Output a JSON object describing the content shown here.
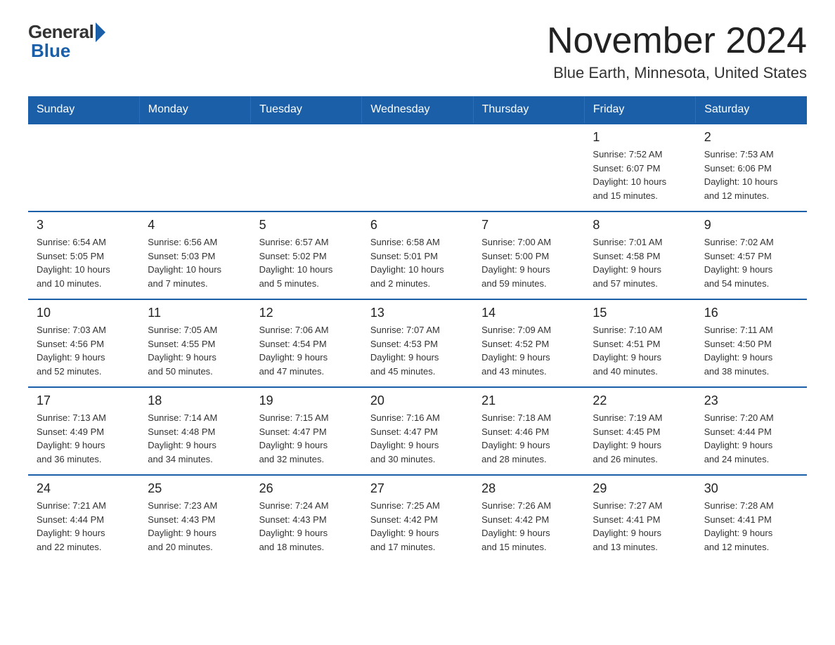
{
  "logo": {
    "general": "General",
    "blue": "Blue"
  },
  "title": "November 2024",
  "location": "Blue Earth, Minnesota, United States",
  "days_header": [
    "Sunday",
    "Monday",
    "Tuesday",
    "Wednesday",
    "Thursday",
    "Friday",
    "Saturday"
  ],
  "weeks": [
    [
      {
        "day": "",
        "info": ""
      },
      {
        "day": "",
        "info": ""
      },
      {
        "day": "",
        "info": ""
      },
      {
        "day": "",
        "info": ""
      },
      {
        "day": "",
        "info": ""
      },
      {
        "day": "1",
        "info": "Sunrise: 7:52 AM\nSunset: 6:07 PM\nDaylight: 10 hours\nand 15 minutes."
      },
      {
        "day": "2",
        "info": "Sunrise: 7:53 AM\nSunset: 6:06 PM\nDaylight: 10 hours\nand 12 minutes."
      }
    ],
    [
      {
        "day": "3",
        "info": "Sunrise: 6:54 AM\nSunset: 5:05 PM\nDaylight: 10 hours\nand 10 minutes."
      },
      {
        "day": "4",
        "info": "Sunrise: 6:56 AM\nSunset: 5:03 PM\nDaylight: 10 hours\nand 7 minutes."
      },
      {
        "day": "5",
        "info": "Sunrise: 6:57 AM\nSunset: 5:02 PM\nDaylight: 10 hours\nand 5 minutes."
      },
      {
        "day": "6",
        "info": "Sunrise: 6:58 AM\nSunset: 5:01 PM\nDaylight: 10 hours\nand 2 minutes."
      },
      {
        "day": "7",
        "info": "Sunrise: 7:00 AM\nSunset: 5:00 PM\nDaylight: 9 hours\nand 59 minutes."
      },
      {
        "day": "8",
        "info": "Sunrise: 7:01 AM\nSunset: 4:58 PM\nDaylight: 9 hours\nand 57 minutes."
      },
      {
        "day": "9",
        "info": "Sunrise: 7:02 AM\nSunset: 4:57 PM\nDaylight: 9 hours\nand 54 minutes."
      }
    ],
    [
      {
        "day": "10",
        "info": "Sunrise: 7:03 AM\nSunset: 4:56 PM\nDaylight: 9 hours\nand 52 minutes."
      },
      {
        "day": "11",
        "info": "Sunrise: 7:05 AM\nSunset: 4:55 PM\nDaylight: 9 hours\nand 50 minutes."
      },
      {
        "day": "12",
        "info": "Sunrise: 7:06 AM\nSunset: 4:54 PM\nDaylight: 9 hours\nand 47 minutes."
      },
      {
        "day": "13",
        "info": "Sunrise: 7:07 AM\nSunset: 4:53 PM\nDaylight: 9 hours\nand 45 minutes."
      },
      {
        "day": "14",
        "info": "Sunrise: 7:09 AM\nSunset: 4:52 PM\nDaylight: 9 hours\nand 43 minutes."
      },
      {
        "day": "15",
        "info": "Sunrise: 7:10 AM\nSunset: 4:51 PM\nDaylight: 9 hours\nand 40 minutes."
      },
      {
        "day": "16",
        "info": "Sunrise: 7:11 AM\nSunset: 4:50 PM\nDaylight: 9 hours\nand 38 minutes."
      }
    ],
    [
      {
        "day": "17",
        "info": "Sunrise: 7:13 AM\nSunset: 4:49 PM\nDaylight: 9 hours\nand 36 minutes."
      },
      {
        "day": "18",
        "info": "Sunrise: 7:14 AM\nSunset: 4:48 PM\nDaylight: 9 hours\nand 34 minutes."
      },
      {
        "day": "19",
        "info": "Sunrise: 7:15 AM\nSunset: 4:47 PM\nDaylight: 9 hours\nand 32 minutes."
      },
      {
        "day": "20",
        "info": "Sunrise: 7:16 AM\nSunset: 4:47 PM\nDaylight: 9 hours\nand 30 minutes."
      },
      {
        "day": "21",
        "info": "Sunrise: 7:18 AM\nSunset: 4:46 PM\nDaylight: 9 hours\nand 28 minutes."
      },
      {
        "day": "22",
        "info": "Sunrise: 7:19 AM\nSunset: 4:45 PM\nDaylight: 9 hours\nand 26 minutes."
      },
      {
        "day": "23",
        "info": "Sunrise: 7:20 AM\nSunset: 4:44 PM\nDaylight: 9 hours\nand 24 minutes."
      }
    ],
    [
      {
        "day": "24",
        "info": "Sunrise: 7:21 AM\nSunset: 4:44 PM\nDaylight: 9 hours\nand 22 minutes."
      },
      {
        "day": "25",
        "info": "Sunrise: 7:23 AM\nSunset: 4:43 PM\nDaylight: 9 hours\nand 20 minutes."
      },
      {
        "day": "26",
        "info": "Sunrise: 7:24 AM\nSunset: 4:43 PM\nDaylight: 9 hours\nand 18 minutes."
      },
      {
        "day": "27",
        "info": "Sunrise: 7:25 AM\nSunset: 4:42 PM\nDaylight: 9 hours\nand 17 minutes."
      },
      {
        "day": "28",
        "info": "Sunrise: 7:26 AM\nSunset: 4:42 PM\nDaylight: 9 hours\nand 15 minutes."
      },
      {
        "day": "29",
        "info": "Sunrise: 7:27 AM\nSunset: 4:41 PM\nDaylight: 9 hours\nand 13 minutes."
      },
      {
        "day": "30",
        "info": "Sunrise: 7:28 AM\nSunset: 4:41 PM\nDaylight: 9 hours\nand 12 minutes."
      }
    ]
  ]
}
